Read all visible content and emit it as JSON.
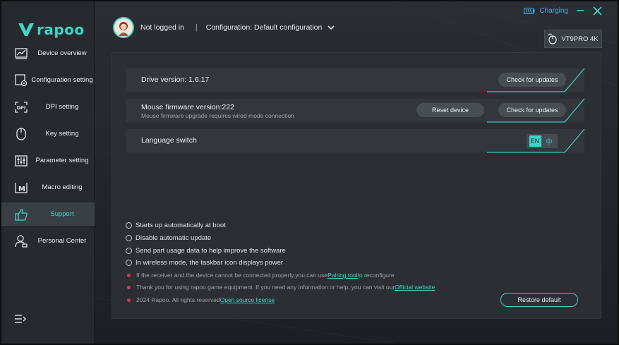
{
  "brand": {
    "logo_text": "rapoo"
  },
  "window": {
    "charging_label": "Charging"
  },
  "header": {
    "user_status": "Not logged in",
    "separator": "|",
    "configuration_label": "Configuration: Default configuration"
  },
  "device": {
    "model": "VT9PRO 4K"
  },
  "sidebar": {
    "items": [
      {
        "label": "Device overview",
        "icon": "device-overview-icon"
      },
      {
        "label": "Configuration setting",
        "icon": "configuration-icon"
      },
      {
        "label": "DPI setting",
        "icon": "dpi-icon"
      },
      {
        "label": "Key setting",
        "icon": "mouse-key-icon"
      },
      {
        "label": "Parameter setting",
        "icon": "parameter-icon"
      },
      {
        "label": "Macro editing",
        "icon": "macro-icon"
      },
      {
        "label": "Support",
        "icon": "thumbs-up-icon",
        "active": true
      },
      {
        "label": "Personal Center",
        "icon": "person-icon"
      }
    ]
  },
  "support": {
    "drive_version": "Drive version: 1.6.17",
    "check_updates_label": "Check for updates",
    "firmware_version": "Mouse firmware version:222",
    "firmware_note": "Mouse firmware upgrade requires wired mode connection",
    "reset_device_label": "Reset device",
    "language_switch_label": "Language switch",
    "lang_en": "EN",
    "lang_zh": "中",
    "options": [
      "Starts up automatically at boot",
      "Disable automatic update",
      "Send part usage data to help improve the software",
      "In wireless mode, the taskbar icon displays power"
    ],
    "notes": {
      "pairing_prefix": "If the receiver and the device cannot be connected properly,you can use ",
      "pairing_link": "Pairing tool",
      "pairing_suffix": " to reconfigure",
      "thanks_prefix": "Thank you for using rapoo game equipment. If you need any information or help, you can visit our ",
      "thanks_link": "Official website",
      "copyright_prefix": "2024 Rapoo. All rights reserved",
      "license_link": "Open source license"
    },
    "restore_default_label": "Restore default"
  },
  "colors": {
    "accent": "#3ad6c6",
    "alert_dot": "#e0344a",
    "charging": "#3fa9e0"
  }
}
